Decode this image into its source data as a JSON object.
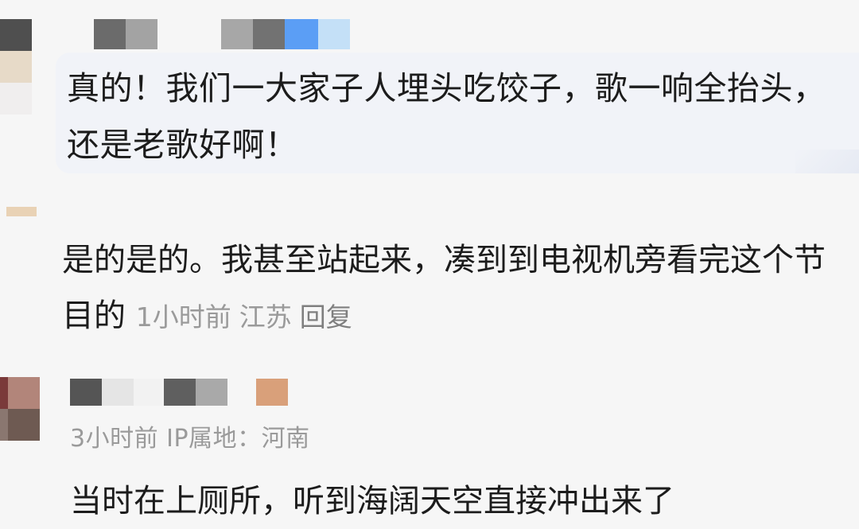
{
  "comments": [
    {
      "username": "",
      "text": "真的！我们一大家子人埋头吃饺子，歌一响全抬头，还是老歌好啊！"
    },
    {
      "username": "",
      "text": "是的是的。我甚至站起来，凑到到电视机旁看完这个节目的",
      "time": "1小时前",
      "location": "江苏",
      "reply": "回复"
    },
    {
      "username": "",
      "time": "3小时前",
      "ip_label": "IP属地：",
      "ip_location": "河南",
      "text": "当时在上厕所，听到海阔天空直接冲出来了"
    }
  ],
  "colors": {
    "background": "#f6f6f6",
    "bubble": "#f1f3f8",
    "text": "#1c1c1c",
    "meta": "#9a9a9a"
  }
}
